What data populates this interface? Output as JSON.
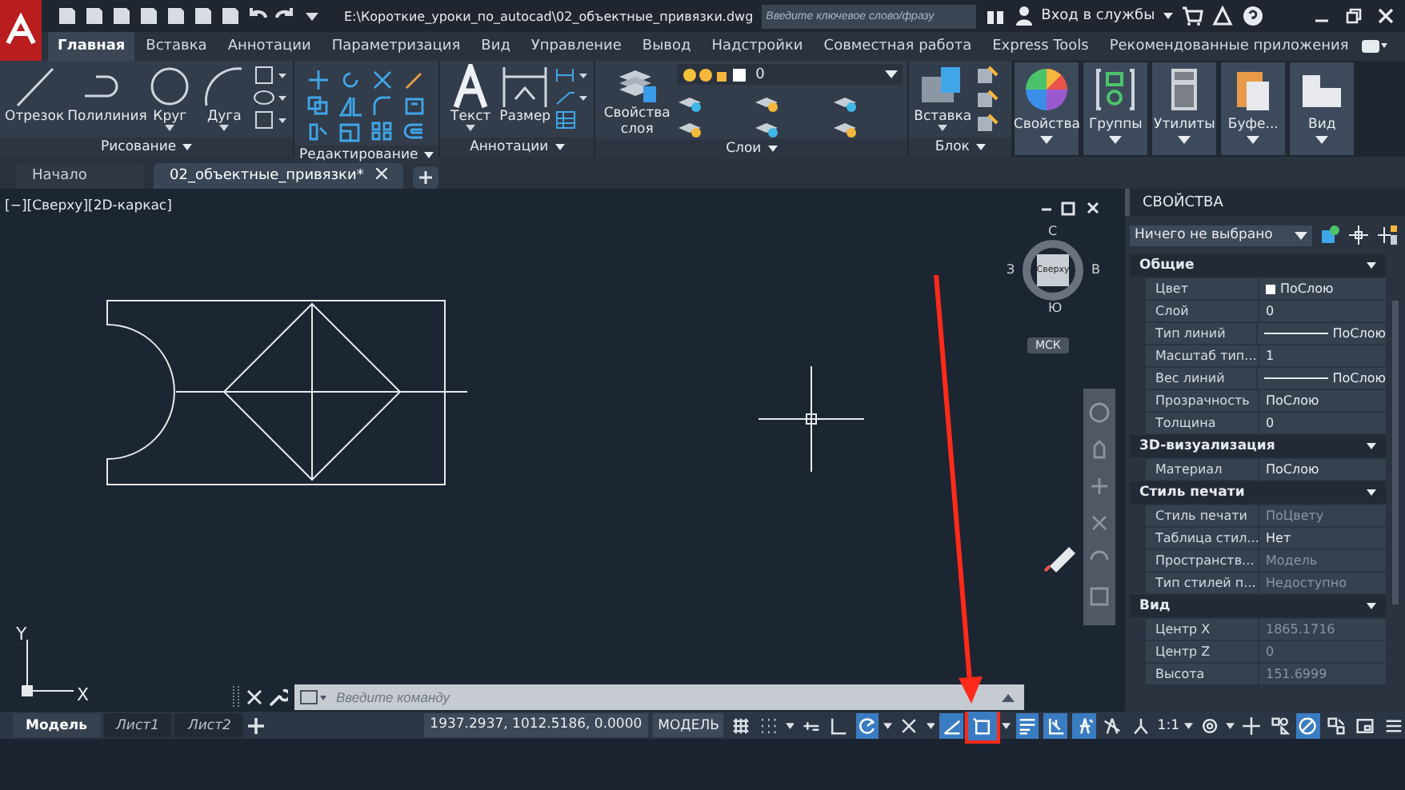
{
  "title_bar": {
    "path": "E:\\Короткие_уроки_по_autocad\\02_объектные_привязки.dwg",
    "search_placeholder": "Введите ключевое слово/фразу",
    "sign_in": "Вход в службы"
  },
  "ribbon_tabs": [
    {
      "label": "Главная",
      "selected": true
    },
    {
      "label": "Вставка",
      "selected": false
    },
    {
      "label": "Аннотации",
      "selected": false
    },
    {
      "label": "Параметризация",
      "selected": false
    },
    {
      "label": "Вид",
      "selected": false
    },
    {
      "label": "Управление",
      "selected": false
    },
    {
      "label": "Вывод",
      "selected": false
    },
    {
      "label": "Надстройки",
      "selected": false
    },
    {
      "label": "Совместная работа",
      "selected": false
    },
    {
      "label": "Express Tools",
      "selected": false
    },
    {
      "label": "Рекомендованные приложения",
      "selected": false
    }
  ],
  "ribbon_panels": [
    {
      "kind": "draw",
      "title": "Рисование",
      "tools": [
        {
          "label": "Отрезок",
          "kind": "line"
        },
        {
          "label": "Полилиния",
          "kind": "polyline"
        },
        {
          "label": "Круг",
          "kind": "circle"
        },
        {
          "label": "Дуга",
          "kind": "arc"
        }
      ]
    },
    {
      "kind": "modify",
      "title": "Редактирование"
    },
    {
      "kind": "annotate",
      "title": "Аннотации",
      "tools": [
        {
          "label": "Текст",
          "kind": "text"
        },
        {
          "label": "Размер",
          "kind": "dimension"
        }
      ]
    },
    {
      "kind": "layers",
      "title": "Слои",
      "layer": "0",
      "tools": [
        {
          "label": "Свойства слоя",
          "kind": "layers"
        }
      ]
    },
    {
      "kind": "block",
      "title": "Блок",
      "tools": [
        {
          "label": "Вставка",
          "kind": "insert"
        }
      ]
    },
    {
      "kind": "collapsed",
      "title": "Свойства",
      "tools": [
        {
          "kind": "palette"
        }
      ]
    },
    {
      "kind": "collapsed",
      "title": "Группы",
      "tools": [
        {
          "kind": "groups"
        }
      ]
    },
    {
      "kind": "collapsed",
      "title": "Утилиты",
      "tools": [
        {
          "kind": "calculator"
        }
      ]
    },
    {
      "kind": "collapsed",
      "title": "Буфе...",
      "tools": [
        {
          "kind": "clipboard"
        }
      ]
    },
    {
      "kind": "collapsed",
      "title": "Вид",
      "tools": [
        {
          "kind": "view"
        }
      ]
    }
  ],
  "file_tabs": [
    {
      "label": "Начало",
      "selected": false,
      "closable": false
    },
    {
      "label": "02_объектные_привязки*",
      "selected": true,
      "closable": true
    }
  ],
  "viewport": {
    "label": "[−][Сверху][2D-каркас]",
    "view_cube": {
      "face": "Сверху",
      "north": "С",
      "south": "Ю",
      "west": "З",
      "east": "В",
      "ucs": "МСК"
    },
    "ucs_icon": {
      "x": "X",
      "y": "Y"
    }
  },
  "command_line": {
    "placeholder": "Введите команду"
  },
  "layout_tabs": [
    {
      "label": "Модель",
      "selected": true
    },
    {
      "label": "Лист1",
      "selected": false
    },
    {
      "label": "Лист2",
      "selected": false
    }
  ],
  "status_bar": {
    "coords": "1937.2937, 1012.5186, 0.0000",
    "mode": "МОДЕЛЬ",
    "toggles": [
      {
        "kind": "grid",
        "on": false,
        "menu": false,
        "marked": false
      },
      {
        "kind": "snap",
        "on": false,
        "menu": true,
        "marked": false
      },
      {
        "kind": "infer",
        "on": false,
        "menu": false,
        "marked": false
      },
      {
        "kind": "ortho",
        "on": false,
        "menu": false,
        "marked": false
      },
      {
        "kind": "polar",
        "on": true,
        "menu": true,
        "marked": false
      },
      {
        "kind": "iso",
        "on": false,
        "menu": true,
        "marked": false
      },
      {
        "kind": "tracking",
        "on": true,
        "menu": false,
        "marked": false
      },
      {
        "kind": "osnap",
        "on": true,
        "menu": true,
        "marked": true
      },
      {
        "kind": "lineweight",
        "on": true,
        "menu": false,
        "marked": false
      },
      {
        "kind": "transparency",
        "on": true,
        "menu": false,
        "marked": false
      },
      {
        "kind": "annovis",
        "on": true,
        "menu": false,
        "marked": false
      },
      {
        "kind": "annoauto",
        "on": false,
        "menu": false,
        "marked": false
      },
      {
        "kind": "annoscale",
        "on": false,
        "menu": false,
        "marked": false
      }
    ],
    "scale": "1:1",
    "toggles_right": [
      {
        "kind": "gear",
        "on": false,
        "menu": true,
        "marked": false
      },
      {
        "kind": "plus",
        "on": false,
        "menu": false,
        "marked": false
      },
      {
        "kind": "cycle",
        "on": false,
        "menu": false,
        "marked": false
      },
      {
        "kind": "isolate",
        "on": true,
        "menu": false,
        "marked": false
      },
      {
        "kind": "hardware",
        "on": false,
        "menu": false,
        "marked": false
      },
      {
        "kind": "clean",
        "on": false,
        "menu": false,
        "marked": false
      },
      {
        "kind": "customize",
        "on": false,
        "menu": false,
        "marked": false
      }
    ]
  },
  "properties": {
    "title": "СВОЙСТВА",
    "selection": "Ничего не выбрано",
    "sections": [
      {
        "title": "Общие",
        "rows": [
          {
            "label": "Цвет",
            "value": "ПоСлою",
            "kind": "swatch",
            "disabled": false
          },
          {
            "label": "Слой",
            "value": "0",
            "kind": "plain",
            "disabled": false
          },
          {
            "label": "Тип линий",
            "value": "ПоСлою",
            "kind": "line",
            "disabled": false
          },
          {
            "label": "Масштаб тип...",
            "value": "1",
            "kind": "plain",
            "disabled": false
          },
          {
            "label": "Вес линий",
            "value": "ПоСлою",
            "kind": "line",
            "disabled": false
          },
          {
            "label": "Прозрачность",
            "value": "ПоСлою",
            "kind": "plain",
            "disabled": false
          },
          {
            "label": "Толщина",
            "value": "0",
            "kind": "plain",
            "disabled": false
          }
        ]
      },
      {
        "title": "3D-визуализация",
        "rows": [
          {
            "label": "Материал",
            "value": "ПоСлою",
            "kind": "plain",
            "disabled": false
          }
        ]
      },
      {
        "title": "Стиль печати",
        "rows": [
          {
            "label": "Стиль печати",
            "value": "ПоЦвету",
            "kind": "plain",
            "disabled": true
          },
          {
            "label": "Таблица стил...",
            "value": "Нет",
            "kind": "plain",
            "disabled": false
          },
          {
            "label": "Пространств...",
            "value": "Модель",
            "kind": "plain",
            "disabled": true
          },
          {
            "label": "Тип стилей п...",
            "value": "Недоступно",
            "kind": "plain",
            "disabled": true
          }
        ]
      },
      {
        "title": "Вид",
        "rows": [
          {
            "label": "Центр X",
            "value": "1865.1716",
            "kind": "plain",
            "disabled": true
          },
          {
            "label": "Центр Z",
            "value": "0",
            "kind": "plain",
            "disabled": true
          },
          {
            "label": "Высота",
            "value": "151.6999",
            "kind": "plain",
            "disabled": true
          }
        ]
      }
    ]
  }
}
